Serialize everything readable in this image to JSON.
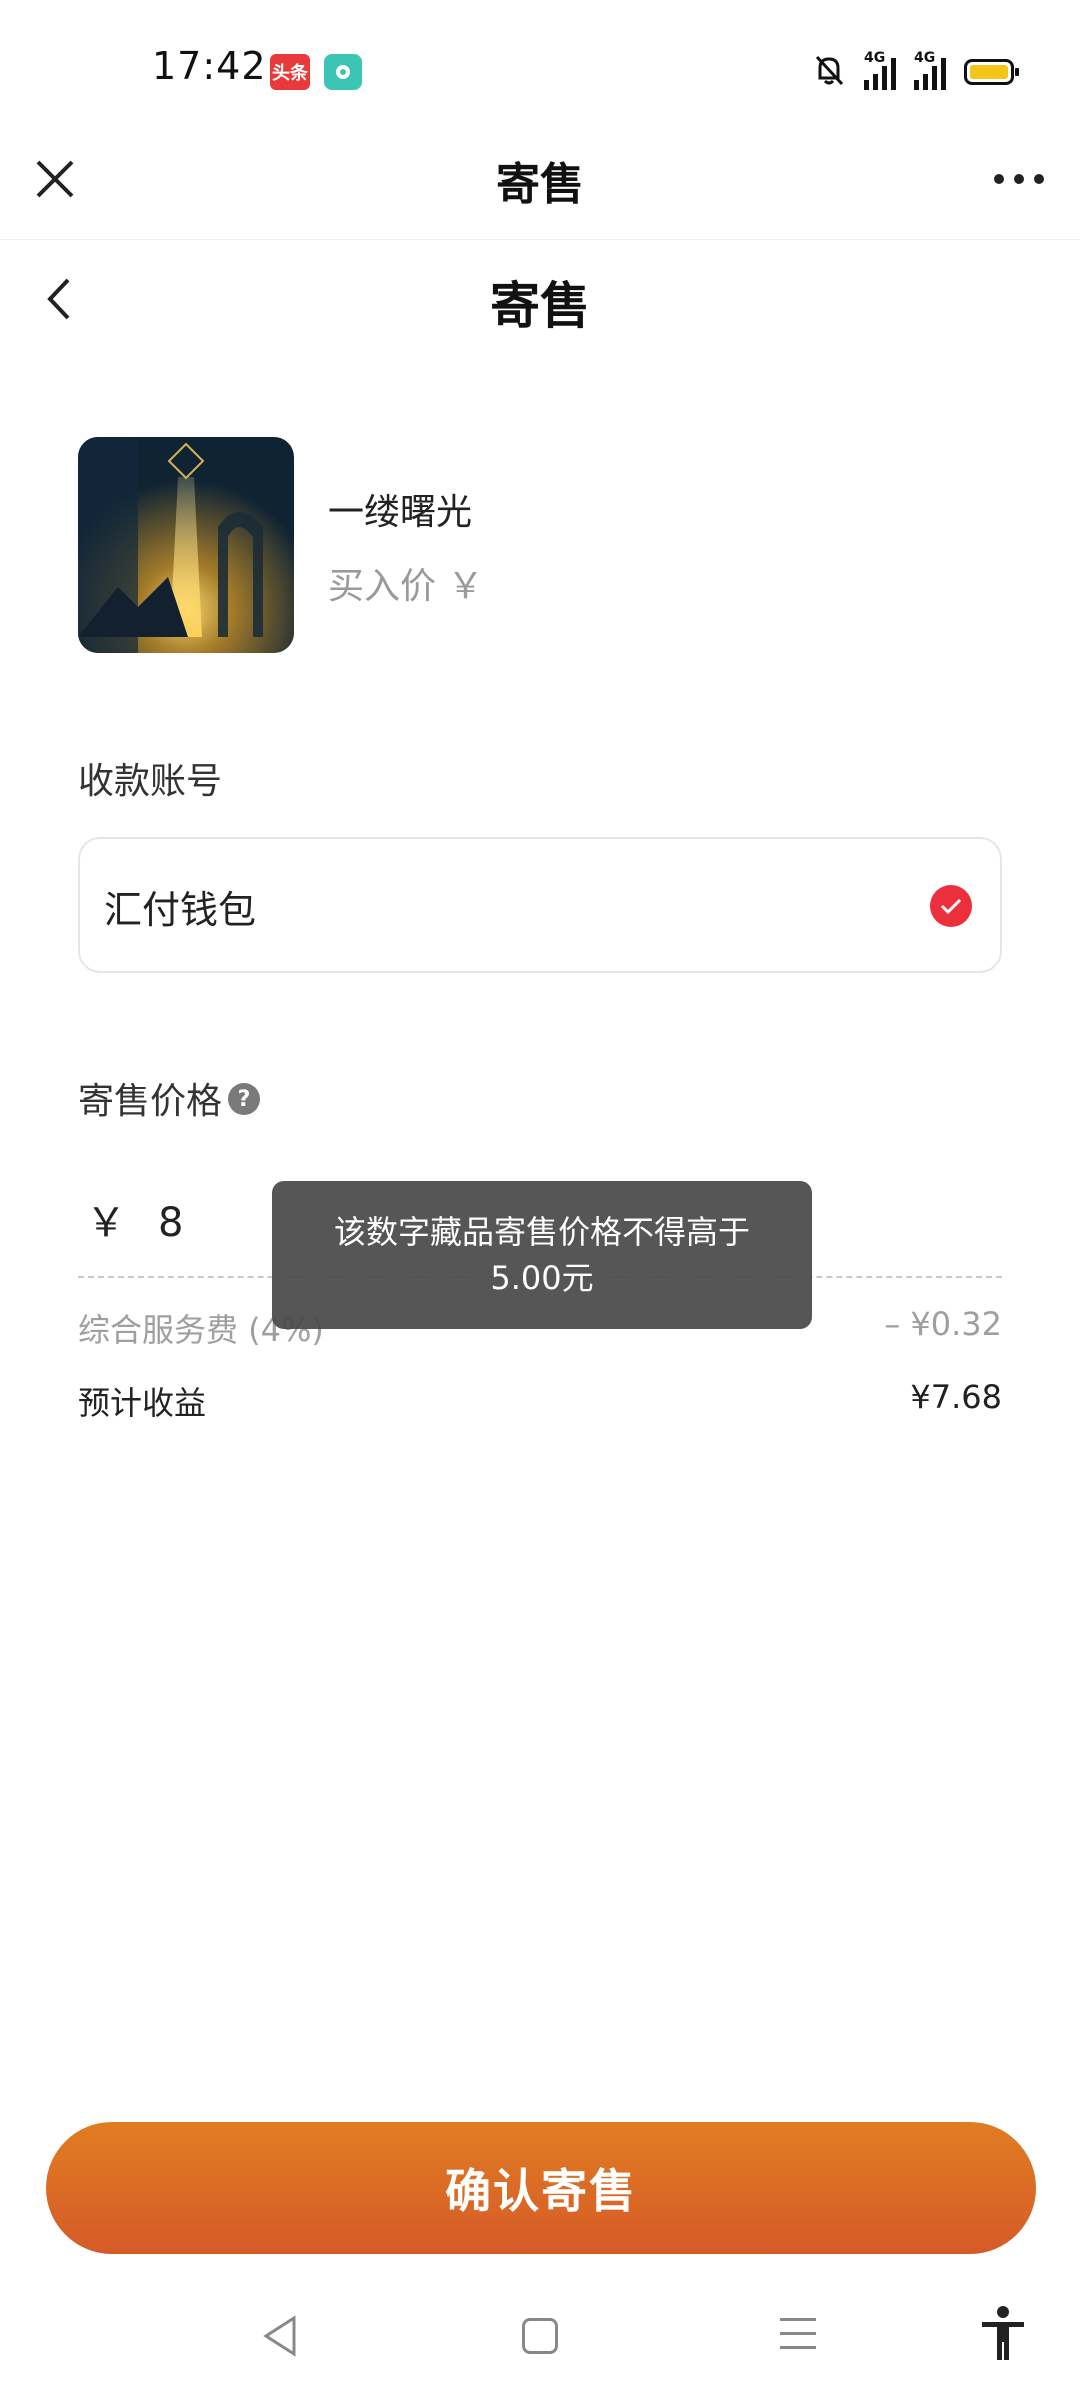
{
  "status_bar": {
    "time": "17:42",
    "app1_label": "头条",
    "signal1_label": "4G",
    "signal2_label": "4G",
    "battery_color": "#f3c619"
  },
  "host_nav": {
    "title": "寄售",
    "close_icon": "close-icon",
    "more_icon": "more-icon"
  },
  "header": {
    "title": "寄售",
    "back_icon": "chevron-left-icon"
  },
  "product": {
    "name": "一缕曙光",
    "price_label": "买入价 ￥"
  },
  "account": {
    "section_label": "收款账号",
    "selected_name": "汇付钱包",
    "selected": true,
    "check_color": "#ec2f3c"
  },
  "price": {
    "section_label": "寄售价格",
    "help_glyph": "?",
    "currency": "￥",
    "value": "8"
  },
  "fees": {
    "service_label": "综合服务费 (4%)",
    "service_value": "– ¥0.32",
    "earnings_label": "预计收益",
    "earnings_value": "¥7.68"
  },
  "toast": {
    "message": "该数字藏品寄售价格不得高于5.00元"
  },
  "confirm": {
    "label": "确认寄售",
    "gradient_top": "#e07d22",
    "gradient_bottom": "#d65a28"
  },
  "system_nav": {
    "back_icon": "triangle-back-icon",
    "home_icon": "square-home-icon",
    "menu_icon": "menu-icon",
    "accessibility_icon": "accessibility-icon"
  }
}
